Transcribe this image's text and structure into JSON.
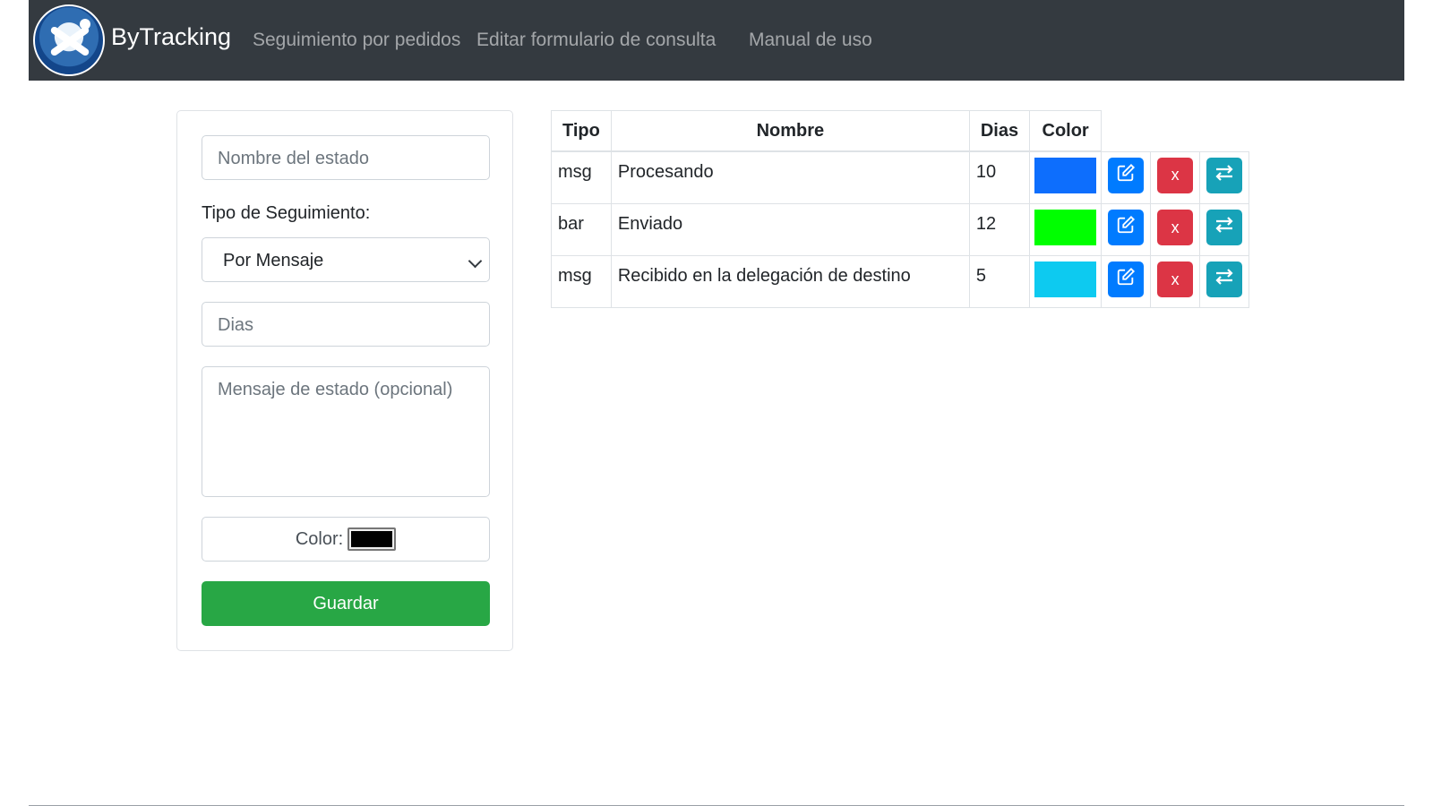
{
  "nav": {
    "brand": "ByTracking",
    "links": [
      "Seguimiento por pedidos",
      "Editar formulario de consulta",
      "Manual de uso"
    ],
    "logo_icon": "bytracking-logo-icon"
  },
  "form": {
    "name_placeholder": "Nombre del estado",
    "tipo_label": "Tipo de Seguimiento:",
    "tipo_value": "Por Mensaje",
    "dias_placeholder": "Dias",
    "mensaje_placeholder": "Mensaje de estado (opcional)",
    "color_label": "Color:",
    "color_value": "#000000",
    "save_label": "Guardar"
  },
  "table": {
    "headers": [
      "Tipo",
      "Nombre",
      "Dias",
      "Color"
    ],
    "rows": [
      {
        "tipo": "msg",
        "nombre": "Procesando",
        "dias": "10",
        "color": "#0d6efd"
      },
      {
        "tipo": "bar",
        "nombre": "Enviado",
        "dias": "12",
        "color": "#00ff00"
      },
      {
        "tipo": "msg",
        "nombre": "Recibido en la delegación de destino",
        "dias": "5",
        "color": "#0dcaf0"
      }
    ],
    "actions": {
      "edit_icon": "edit-icon",
      "delete_label": "x",
      "move_icon": "swap-arrows-icon"
    }
  }
}
